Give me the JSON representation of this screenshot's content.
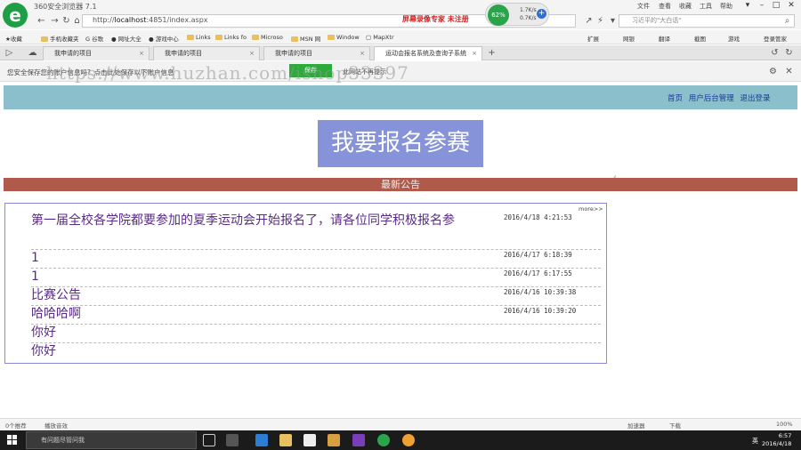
{
  "browser": {
    "name": "360安全浏览器 7.1",
    "logo_letter": "e",
    "recording_text": "屏幕录像专家 未注册",
    "cpu": "62%",
    "net_up": "1.7K/s",
    "net_down": "0.7K/s",
    "title_menu": [
      "文件",
      "查看",
      "收藏",
      "工具",
      "帮助"
    ],
    "url_prefix": "http://",
    "url_host": "localhost",
    "url_rest": ":4851/index.aspx",
    "search_text": "习近平的\"大白话\"",
    "bookmarks": [
      "收藏",
      "手机收藏夹",
      "谷歌",
      "网址大全",
      "游戏中心",
      "Links",
      "Links fo",
      "Microso",
      "MSN 网",
      "Window",
      "MapXtr"
    ],
    "bookmark_right": [
      "扩展",
      "网银",
      "翻译",
      "截图",
      "游戏",
      "登录管家"
    ],
    "tabs": [
      {
        "label": "我申请的项目",
        "active": false
      },
      {
        "label": "我申请的项目",
        "active": false
      },
      {
        "label": "我申请的项目",
        "active": false
      },
      {
        "label": "运动会报名系统及查询子系统",
        "active": true
      }
    ],
    "tab_add": "+",
    "notification": "您安全保存您的账户信息吗？点击此处保存以下账户信息",
    "notification_btn": "保存",
    "notification_right": "此网站不再提示",
    "watermark": "https://www.huzhan.com/ishop33397",
    "status_left": [
      "0个推荐",
      "播放音效"
    ],
    "status_right": [
      "加速器",
      "下载",
      "100%"
    ]
  },
  "page": {
    "header_links": [
      "首页",
      "用户后台管理",
      "退出登录"
    ],
    "register_button": "我要报名参赛",
    "notice_title": "最新公告",
    "more_link": "more>>",
    "notices": [
      {
        "title": "第一届全校各学院都要参加的夏季运动会开始报名了，请各位同学积极报名参",
        "time": "2016/4/18 4:21:53"
      },
      {
        "title": "1",
        "time": "2016/4/17 6:18:39"
      },
      {
        "title": "1",
        "time": "2016/4/17 6:17:55"
      },
      {
        "title": "比赛公告",
        "time": "2016/4/16 10:39:38"
      },
      {
        "title": "哈哈哈啊",
        "time": "2016/4/16 10:39:20"
      },
      {
        "title": "你好",
        "time": ""
      },
      {
        "title": "你好",
        "time": ""
      }
    ]
  },
  "taskbar": {
    "search_placeholder": "有问题尽管问我",
    "lang": "英",
    "time": "6:57",
    "date": "2016/4/18"
  }
}
